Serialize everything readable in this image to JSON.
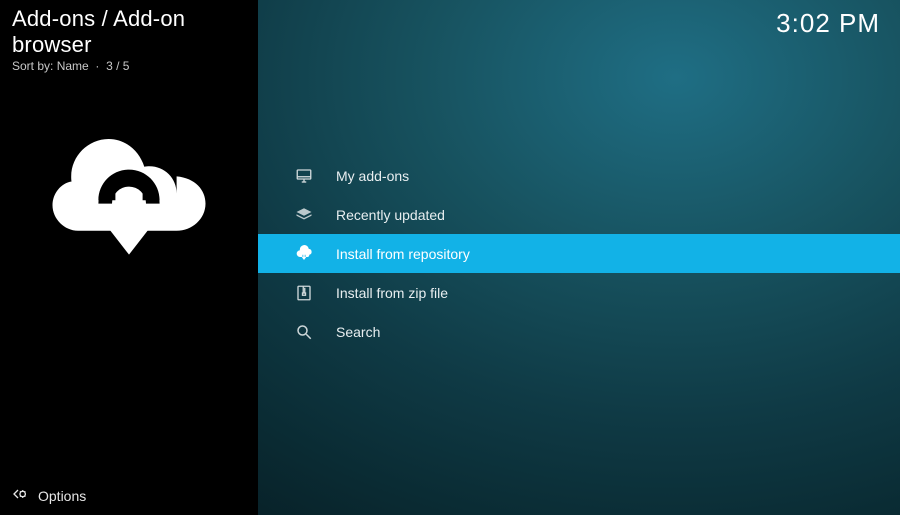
{
  "header": {
    "title": "Add-ons / Add-on browser",
    "sort_label": "Sort by:",
    "sort_value": "Name",
    "position": "3 / 5",
    "clock": "3:02 PM"
  },
  "menu": {
    "items": [
      {
        "icon": "monitor-icon",
        "label": "My add-ons",
        "selected": false
      },
      {
        "icon": "box-open-icon",
        "label": "Recently updated",
        "selected": false
      },
      {
        "icon": "cloud-download-icon",
        "label": "Install from repository",
        "selected": true
      },
      {
        "icon": "zip-file-icon",
        "label": "Install from zip file",
        "selected": false
      },
      {
        "icon": "search-icon",
        "label": "Search",
        "selected": false
      }
    ]
  },
  "footer": {
    "options_label": "Options"
  },
  "colors": {
    "highlight": "#12b2e7",
    "bg_dark": "#000000",
    "bg_teal": "#145b6a"
  }
}
